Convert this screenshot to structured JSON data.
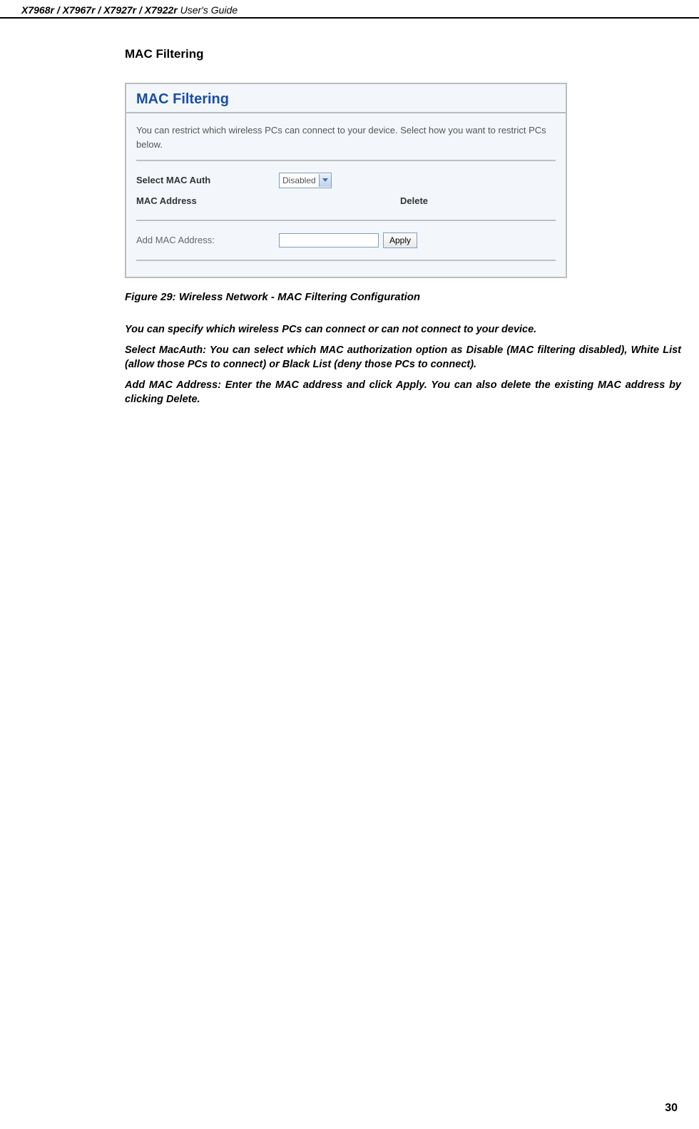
{
  "header": {
    "models": "X7968r / X7967r / X7927r / X7922r",
    "suffix": " User's Guide"
  },
  "section_heading": "MAC Filtering",
  "config": {
    "title": "MAC Filtering",
    "intro": "You can restrict which wireless PCs can connect to your device. Select how you want to restrict PCs below.",
    "select_label": "Select MAC Auth",
    "select_value": "Disabled",
    "mac_address_label": "MAC Address",
    "delete_label": "Delete",
    "add_label": "Add MAC Address:",
    "apply_label": "Apply"
  },
  "figure_caption": "Figure 29: Wireless Network - MAC Filtering Configuration",
  "paragraphs": {
    "p1": "You can specify which wireless PCs can connect or can not connect to your device.",
    "p2": "Select MacAuth: You can select which MAC authorization option as Disable (MAC filtering disabled), White List (allow those PCs to connect) or Black List (deny those PCs to connect).",
    "p3": "Add MAC Address: Enter the MAC address and click Apply. You can also delete the existing MAC address by clicking Delete."
  },
  "page_number": "30"
}
